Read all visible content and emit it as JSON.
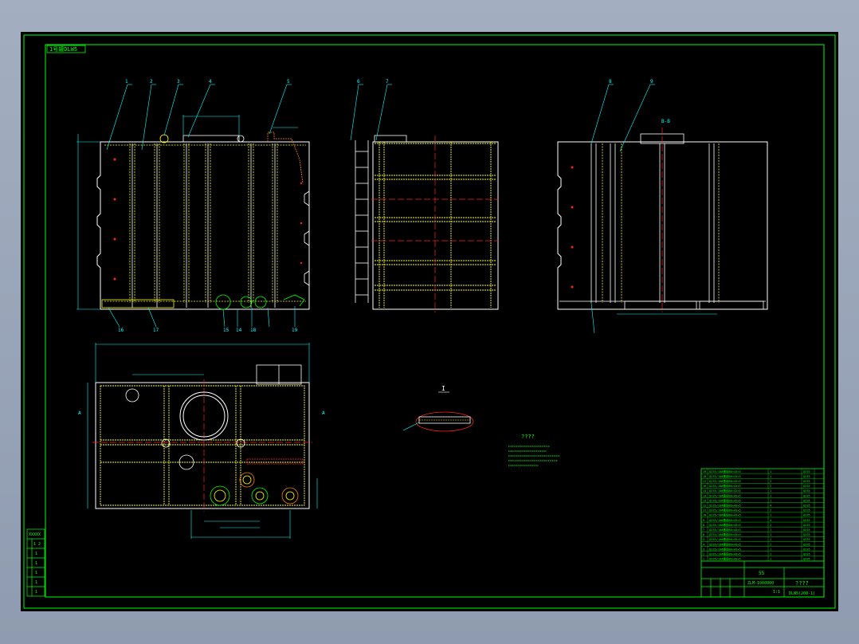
{
  "drawing": {
    "title_tag": "1号罐DLW5",
    "views": [
      {
        "id": "front-elevation",
        "callouts": [
          "1",
          "2",
          "3",
          "4",
          "5"
        ],
        "bottom_callouts": [
          "16",
          "17",
          "15",
          "14",
          "18",
          "19"
        ]
      },
      {
        "id": "side-elevation",
        "callouts": [
          "6",
          "7"
        ]
      },
      {
        "id": "rear-elevation",
        "callouts": [
          "8",
          "9"
        ],
        "section_label": "B-B"
      },
      {
        "id": "plan-view",
        "section_label": "A"
      }
    ],
    "detail_label": "I",
    "notes_title": "????"
  },
  "parts_list": {
    "rows": [
      {
        "no": "19",
        "name": "Q235/10#槽钢80×43×5",
        "qty": "1",
        "mat": "Q235"
      },
      {
        "no": "18",
        "name": "Q235/10#槽钢80×43×5",
        "qty": "1",
        "mat": "Q235"
      },
      {
        "no": "17",
        "name": "Q235/10#槽钢80×43×5",
        "qty": "2",
        "mat": "Q235"
      },
      {
        "no": "16",
        "name": "Q235/10#槽钢80×43×5",
        "qty": "2",
        "mat": "Q235"
      },
      {
        "no": "15",
        "name": "Q235/10#槽钢80×43×5",
        "qty": "1",
        "mat": "Q235"
      },
      {
        "no": "14",
        "name": "Q235/10#槽钢80×43×5",
        "qty": "1",
        "mat": "Q235"
      },
      {
        "no": "13",
        "name": "Q235/10#槽钢80×43×5",
        "qty": "1",
        "mat": "Q235"
      },
      {
        "no": "12",
        "name": "Q235/10#槽钢80×43×5",
        "qty": "4",
        "mat": "Q235"
      },
      {
        "no": "11",
        "name": "Q235/10#槽钢80×43×5",
        "qty": "2",
        "mat": "Q235"
      },
      {
        "no": "10",
        "name": "Q235/10#槽钢80×43×5",
        "qty": "1",
        "mat": "Q235"
      },
      {
        "no": "9",
        "name": "Q235/10#槽钢80×43×5",
        "qty": "4",
        "mat": "Q235"
      },
      {
        "no": "8",
        "name": "Q235/10#槽钢80×43×5",
        "qty": "2",
        "mat": "Q235"
      },
      {
        "no": "7",
        "name": "Q235/10#槽钢80×43×5",
        "qty": "1",
        "mat": "Q235"
      },
      {
        "no": "6",
        "name": "Q235/10#槽钢80×43×5",
        "qty": "1",
        "mat": "Q235"
      },
      {
        "no": "5",
        "name": "Q235/10#槽钢80×43×5",
        "qty": "1",
        "mat": "Q235"
      },
      {
        "no": "4",
        "name": "Q235/10#槽钢80×43×5",
        "qty": "2",
        "mat": "Q235"
      },
      {
        "no": "3",
        "name": "Q235/10#槽钢80×43×5",
        "qty": "1",
        "mat": "Q235"
      },
      {
        "no": "2",
        "name": "Q235/10#槽钢80×43×5",
        "qty": "1",
        "mat": "Q235"
      },
      {
        "no": "1",
        "name": "Q235/10#槽钢80×43×5",
        "qty": "1",
        "mat": "Q235"
      }
    ]
  },
  "title_block": {
    "title": "????",
    "drawing_no": "ZLM-1000000",
    "company": "DLW5(200-1)",
    "scale": "1:1",
    "code": "55"
  },
  "side_strip": {
    "labels": [
      "XXXXX",
      "1 2",
      "1",
      "1",
      "1",
      "1",
      "1",
      "1"
    ]
  },
  "colors": {
    "background": "#000000",
    "frame": "#00ff00",
    "outline": "#ffffff",
    "hidden": "#ffff00",
    "dimension": "#00ffff",
    "centerline": "#ff2020",
    "hatch": "#ff7f00",
    "window_chrome": "#9aa5b8"
  }
}
